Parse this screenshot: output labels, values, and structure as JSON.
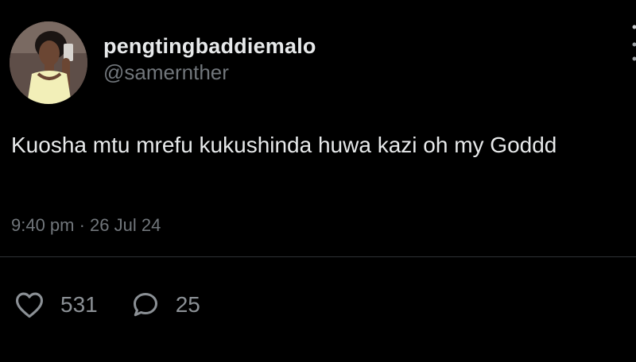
{
  "tweet": {
    "author": {
      "display_name": "pengtingbaddiemalo",
      "handle": "@samernther"
    },
    "text": "Kuosha mtu mrefu kukushinda huwa kazi oh my Goddd",
    "timestamp": "9:40 pm · 26 Jul 24",
    "stats": {
      "likes": "531",
      "replies": "25"
    }
  },
  "icons": {
    "like": "heart-outline-icon",
    "reply": "speech-bubble-icon"
  },
  "colors": {
    "background": "#000000",
    "primary_text": "#e7e9ea",
    "secondary_text": "#71767b",
    "divider": "#2f3336"
  }
}
